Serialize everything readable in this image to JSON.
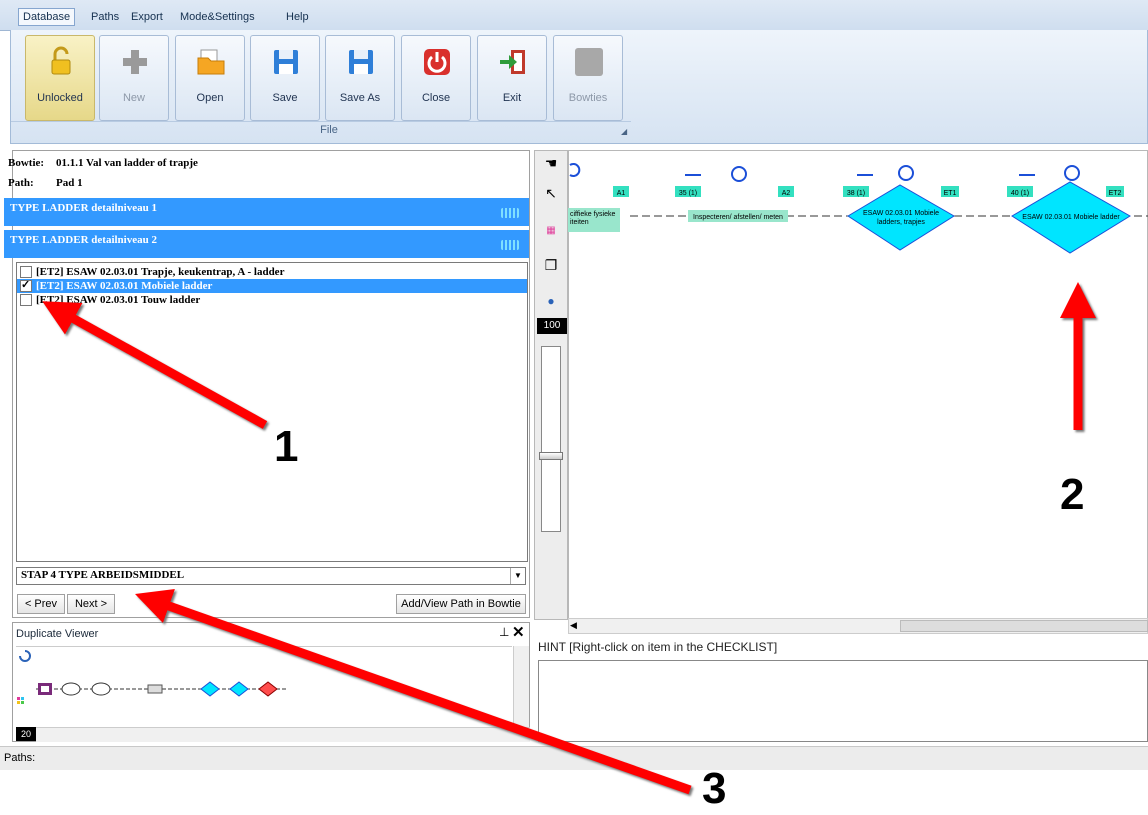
{
  "menu": [
    "Database",
    "Paths",
    "Export",
    "Mode&Settings",
    "Help"
  ],
  "ribbon": {
    "buttons": [
      "Unlocked",
      "New",
      "Open",
      "Save",
      "Save As",
      "Close",
      "Exit",
      "Bowties"
    ],
    "group_label": "File"
  },
  "info": {
    "bowtie_key": "Bowtie:",
    "bowtie_value": "01.1.1 Val van ladder of trapje",
    "path_key": "Path:",
    "path_value": "Pad 1"
  },
  "levels": [
    "TYPE LADDER detailniveau 1",
    "TYPE LADDER detailniveau 2"
  ],
  "checklist": [
    {
      "text": "[ET2] ESAW 02.03.01 Trapje, keukentrap, A - ladder",
      "checked": false,
      "selected": false
    },
    {
      "text": "[ET2] ESAW 02.03.01 Mobiele ladder",
      "checked": true,
      "selected": true
    },
    {
      "text": "[ET2] ESAW 02.03.01 Touw ladder",
      "checked": false,
      "selected": false
    }
  ],
  "step_select": "STAP 4 TYPE ARBEIDSMIDDEL",
  "nav": {
    "prev": "< Prev",
    "next": "Next >",
    "add_view": "Add/View Path in Bowtie"
  },
  "duplicate_viewer": {
    "title": "Duplicate Viewer",
    "zoom": "20"
  },
  "zoom_value": "100",
  "diagram": {
    "tags": [
      "A1",
      "35 (1)",
      "A2",
      "38 (1)",
      "ET1",
      "40 (1)",
      "ET2"
    ],
    "labels": [
      "ciffieke fysieke\niteiten",
      "Inspecteren/ afstellen/ meten",
      "ESAW 02.03.01 Mobiele\nladders, trapjes",
      "ESAW 02.03.01 Mobiele ladder"
    ]
  },
  "hint": "HINT [Right-click on item in the CHECKLIST]",
  "status": "Paths:",
  "callouts": [
    "1",
    "2",
    "3"
  ],
  "colors": {
    "selection": "#3399ff",
    "diamond": "#00e5ff",
    "arrow": "#ff0000",
    "tag": "#33e0c0"
  }
}
